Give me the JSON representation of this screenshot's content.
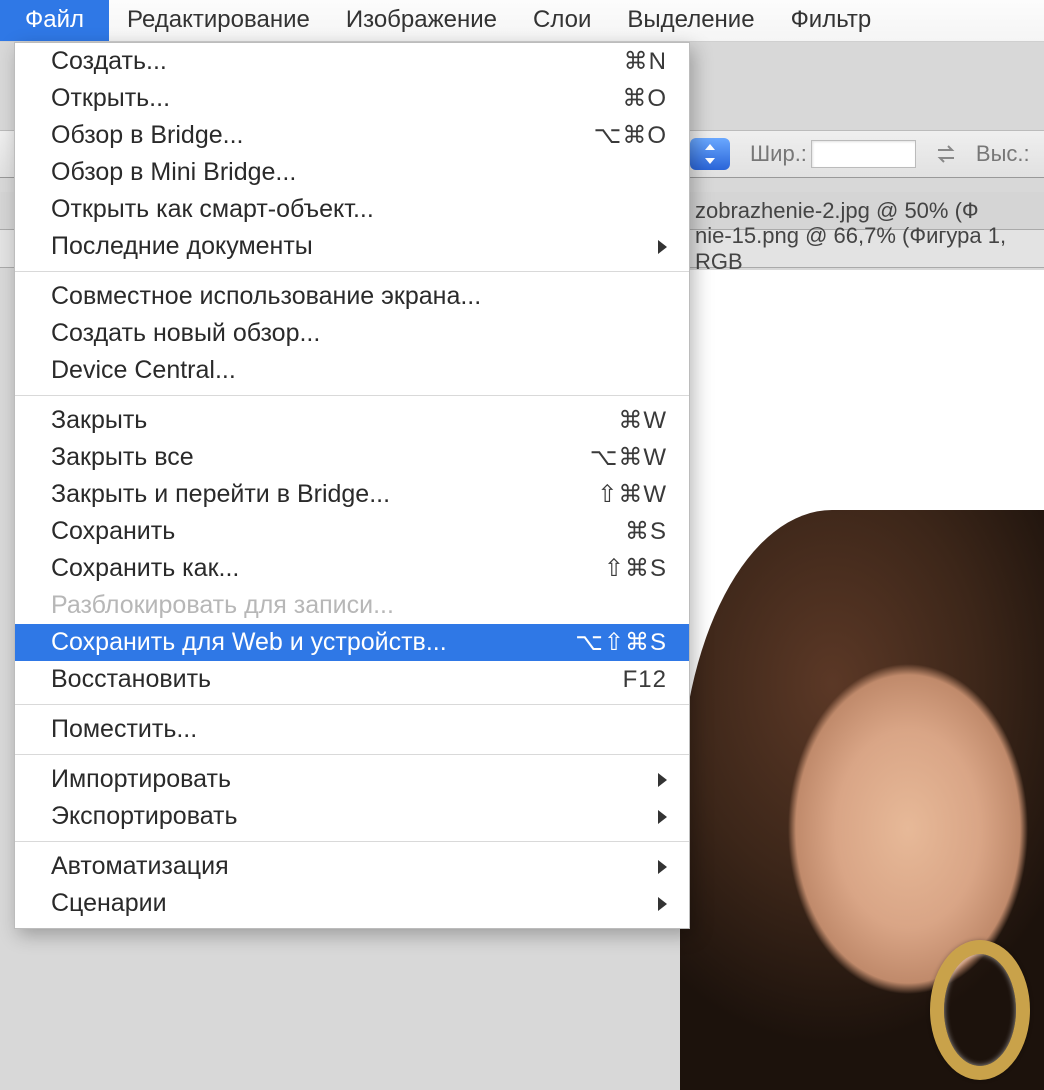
{
  "menubar": {
    "items": [
      "Файл",
      "Редактирование",
      "Изображение",
      "Слои",
      "Выделение",
      "Фильтр"
    ],
    "active_index": 0
  },
  "options_bar": {
    "width_label": "Шир.:",
    "height_label": "Выс.:",
    "width_value": "",
    "height_value": ""
  },
  "tabs": {
    "row1": "zobrazhenie-2.jpg @ 50% (Ф",
    "row2": "nie-15.png @ 66,7% (Фигура 1, RGB"
  },
  "dropdown": {
    "groups": [
      [
        {
          "label": "Создать...",
          "shortcut": "⌘N"
        },
        {
          "label": "Открыть...",
          "shortcut": "⌘O"
        },
        {
          "label": "Обзор в Bridge...",
          "shortcut": "⌥⌘O"
        },
        {
          "label": "Обзор в Mini Bridge..."
        },
        {
          "label": "Открыть как смарт-объект..."
        },
        {
          "label": "Последние документы",
          "submenu": true
        }
      ],
      [
        {
          "label": "Совместное использование экрана..."
        },
        {
          "label": "Создать новый обзор..."
        },
        {
          "label": "Device Central..."
        }
      ],
      [
        {
          "label": "Закрыть",
          "shortcut": "⌘W"
        },
        {
          "label": "Закрыть все",
          "shortcut": "⌥⌘W"
        },
        {
          "label": "Закрыть и перейти в Bridge...",
          "shortcut": "⇧⌘W"
        },
        {
          "label": "Сохранить",
          "shortcut": "⌘S"
        },
        {
          "label": "Сохранить как...",
          "shortcut": "⇧⌘S"
        },
        {
          "label": "Разблокировать для записи...",
          "disabled": true
        },
        {
          "label": "Сохранить для Web и устройств...",
          "shortcut": "⌥⇧⌘S",
          "selected": true
        },
        {
          "label": "Восстановить",
          "shortcut": "F12"
        }
      ],
      [
        {
          "label": "Поместить..."
        }
      ],
      [
        {
          "label": "Импортировать",
          "submenu": true
        },
        {
          "label": "Экспортировать",
          "submenu": true
        }
      ],
      [
        {
          "label": "Автоматизация",
          "submenu": true
        },
        {
          "label": "Сценарии",
          "submenu": true
        }
      ]
    ]
  }
}
